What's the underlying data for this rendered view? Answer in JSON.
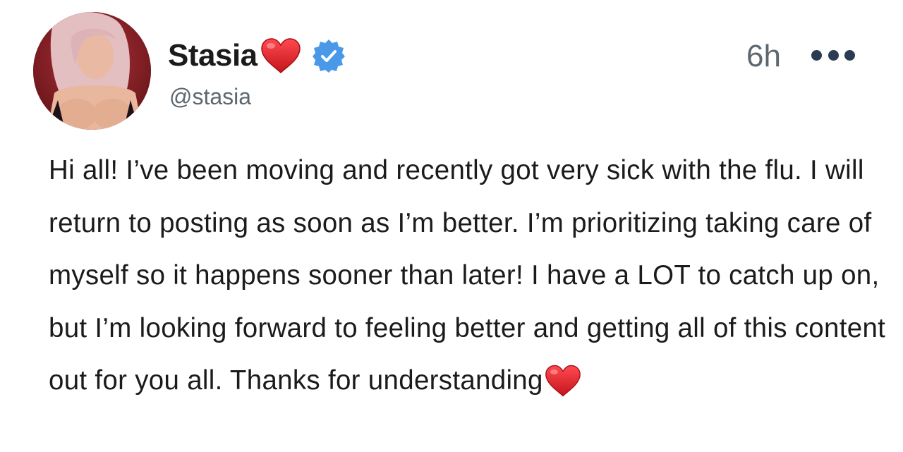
{
  "post": {
    "display_name": "Stasia",
    "handle": "@stasia",
    "timestamp": "6h",
    "name_emoji_icon": "red-heart-icon",
    "verified_icon": "verified-badge-icon",
    "more_icon": "more-options-icon",
    "body_text": "Hi all! I’ve been moving and recently got very sick with the flu. I will return to posting as soon as I’m better. I’m prioritizing taking care of myself so it happens sooner than later! I have a LOT to catch up on, but I’m looking forward to feeling better and getting all of this content out for you all. Thanks for understanding",
    "body_trailing_emoji_icon": "red-heart-icon"
  },
  "colors": {
    "text": "#1b1b1b",
    "secondary_text": "#5d6770",
    "verified_blue": "#4a99e9",
    "heart_red": "#e0262f",
    "more_dots": "#2a3b52"
  }
}
